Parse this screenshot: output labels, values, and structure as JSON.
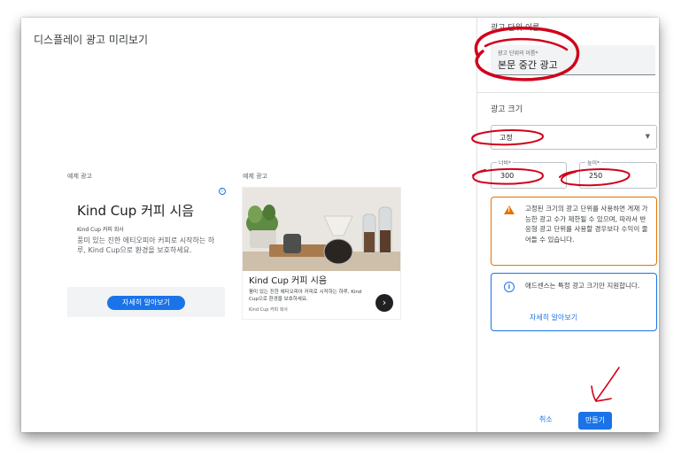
{
  "preview": {
    "title": "디스플레이 광고 미리보기",
    "ad_label_1": "예제 광고",
    "ad_label_2": "예제 광고"
  },
  "ad1": {
    "title": "Kind Cup 커피 시음",
    "company": "Kind Cup 커피 회사",
    "description": "풍미 있는 진한 에티오피아 커피로 시작하는 하루, Kind Cup으로 환경을 보호하세요.",
    "button": "자세히 알아보기",
    "adchoices_icon": "adchoices-icon"
  },
  "ad2": {
    "title": "Kind Cup 커피 시음",
    "description": "풍미 있는 진한 에티오피아 커피로 시작하는 하루, Kind Cup으로 환경을 보호하세요.",
    "company": "Kind Cup 커피 회사",
    "arrow_icon": "chevron-right-icon",
    "arrow_glyph": "›"
  },
  "panel": {
    "name_section": "광고 단위 이름",
    "name_field_label": "광고 단위의 이름*",
    "name_field_value": "본문 중간 광고",
    "size_section": "광고 크기",
    "size_select_value": "고정",
    "width_label": "너비*",
    "width_value": "300",
    "height_label": "높이*",
    "height_value": "250",
    "warning": "고정된 크기의 광고 단위를 사용하면 게재 가능한 광고 수가 제한될 수 있으며, 따라서 반응형 광고 단위를 사용할 경우보다 수익이 줄어들 수 있습니다.",
    "info": "애드센스는 특정 광고 크기만 지원합니다.",
    "info_link": "자세히 알아보기",
    "cancel": "취소",
    "create": "만들기"
  },
  "colors": {
    "accent": "#1a73e8",
    "warning": "#e37400",
    "annotation": "#d0021b"
  }
}
